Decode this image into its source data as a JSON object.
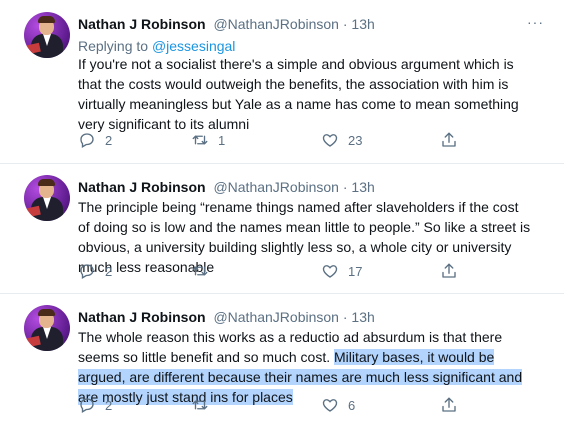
{
  "tweets": [
    {
      "name": "Nathan J Robinson",
      "handle": "@NathanJRobinson",
      "dot": "·",
      "time": "13h",
      "more": "···",
      "replying_prefix": "Replying to",
      "replying_to": "@jessesingal",
      "text": "If you're not a socialist there's a simple and obvious argument which is that the costs would outweigh the benefits, the association with him is virtually meaningless but Yale as a name has come to mean something very significant to its alumni",
      "replies": "2",
      "retweets": "1",
      "likes": "23"
    },
    {
      "name": "Nathan J Robinson",
      "handle": "@NathanJRobinson",
      "dot": "·",
      "time": "13h",
      "more": "",
      "text": "The principle being “rename things named after slaveholders if the cost of doing so is low and the names mean little to people.” So like a street is obvious, a university building slightly less so, a whole city or university much less reasonable",
      "replies": "2",
      "retweets": "",
      "likes": "17"
    },
    {
      "name": "Nathan J Robinson",
      "handle": "@NathanJRobinson",
      "dot": "·",
      "time": "13h",
      "more": "",
      "text_plain": "The whole reason this works as a reductio ad absurdum is that there seems so little benefit and so much cost. ",
      "text_highlighted": "Military bases, it would be argued, are different because their names are much less significant and are mostly just stand ins for places",
      "replies": "2",
      "retweets": "",
      "likes": "6"
    }
  ],
  "colors": {
    "text": "#0f1419",
    "secondary": "#5b7083",
    "link": "#1b95e0",
    "selection": "#b3d4fc",
    "divider": "#e6ecf0"
  },
  "icons": {
    "reply": "reply-icon",
    "retweet": "retweet-icon",
    "like": "heart-icon",
    "share": "share-icon",
    "more": "more-icon"
  }
}
